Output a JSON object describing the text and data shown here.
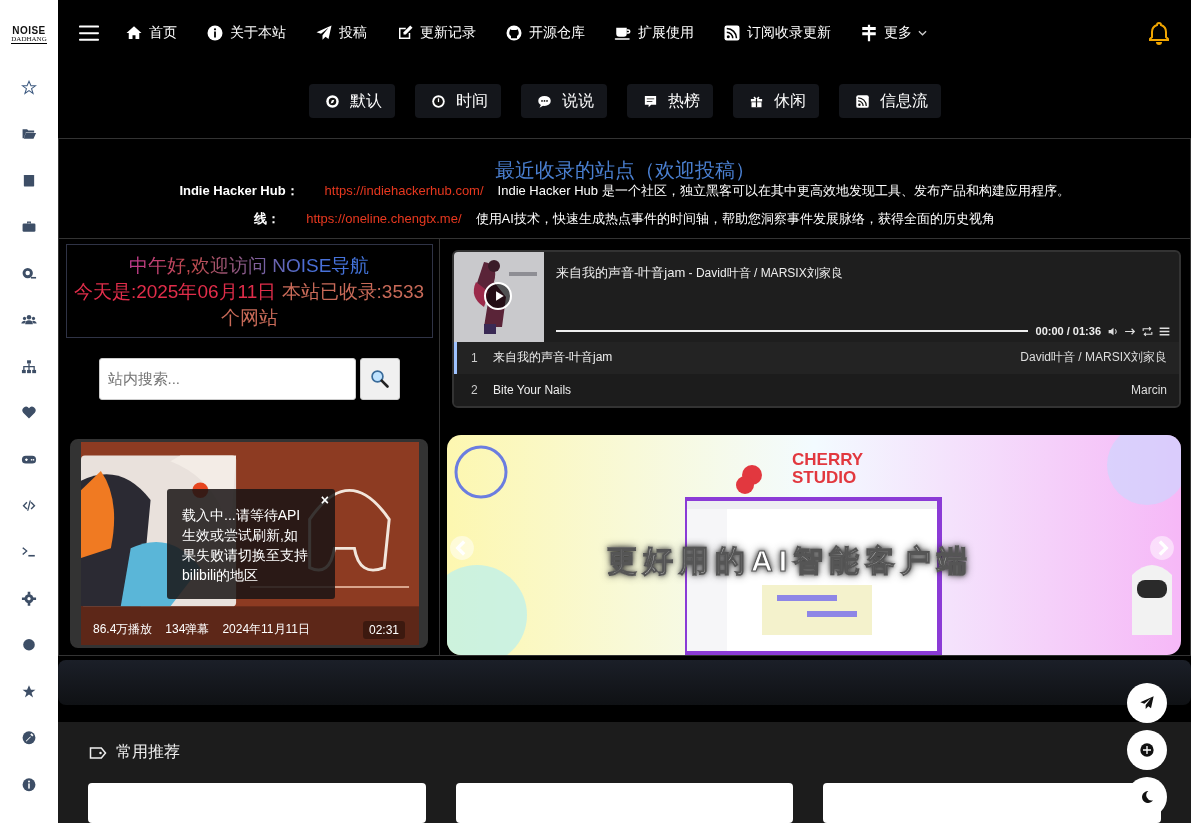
{
  "logo": {
    "title": "NOISE",
    "subtitle": "DADHANG"
  },
  "nav": {
    "items": [
      {
        "label": "首页",
        "dropdown": false
      },
      {
        "label": "关于本站",
        "dropdown": false
      },
      {
        "label": "投稿",
        "dropdown": false
      },
      {
        "label": "更新记录",
        "dropdown": false
      },
      {
        "label": "开源仓库",
        "dropdown": false
      },
      {
        "label": "扩展使用",
        "dropdown": false
      },
      {
        "label": "订阅收录更新",
        "dropdown": false
      },
      {
        "label": "更多",
        "dropdown": true
      }
    ]
  },
  "tabs": [
    {
      "label": "默认"
    },
    {
      "label": "时间"
    },
    {
      "label": "说说"
    },
    {
      "label": "热榜"
    },
    {
      "label": "休闲"
    },
    {
      "label": "信息流"
    }
  ],
  "recent": {
    "title": "最近收录的站点（欢迎投稿）",
    "entries": [
      {
        "name": "Indie Hacker Hub：",
        "url": "https://indiehackerhub.com/",
        "description": "Indie Hacker Hub 是一个社区，独立黑客可以在其中更高效地发现工具、发布产品和构建应用程序。"
      },
      {
        "name": "线：",
        "url": "https://oneline.chengtx.me/",
        "description": "使用AI技术，快速生成热点事件的时间轴，帮助您洞察事件发展脉络，获得全面的历史视角"
      }
    ]
  },
  "greeting": {
    "line1": "中午好,欢迎访问 NOISE导航",
    "date": "今天是:2025年06月11日",
    "count": "本站已收录:3533个网站"
  },
  "search": {
    "placeholder": "站内搜索..."
  },
  "video": {
    "notice": "载入中...请等待API生效或尝试刷新,如果失败请切换至支持bilibili的地区",
    "close": "×",
    "plays": "86.4万播放",
    "danmaku": "134弹幕",
    "date": "2024年11月11日",
    "duration": "02:31"
  },
  "player": {
    "title": "来自我的声音-叶音jam",
    "artist_line": "- David叶音 / MARSIX刘家良",
    "time": "00:00 / 01:36",
    "progress": {
      "level": 0
    },
    "playlist": [
      {
        "index": "1",
        "title": "来自我的声音-叶音jam",
        "artist": "David叶音 / MARSIX刘家良",
        "selected": true
      },
      {
        "index": "2",
        "title": "Bite Your Nails",
        "artist": "Marcin",
        "selected": false
      }
    ]
  },
  "banner": {
    "brand": "CHERRY STUDIO",
    "headline": "更好用的AI智能客户端"
  },
  "section": {
    "title": "常用推荐"
  }
}
